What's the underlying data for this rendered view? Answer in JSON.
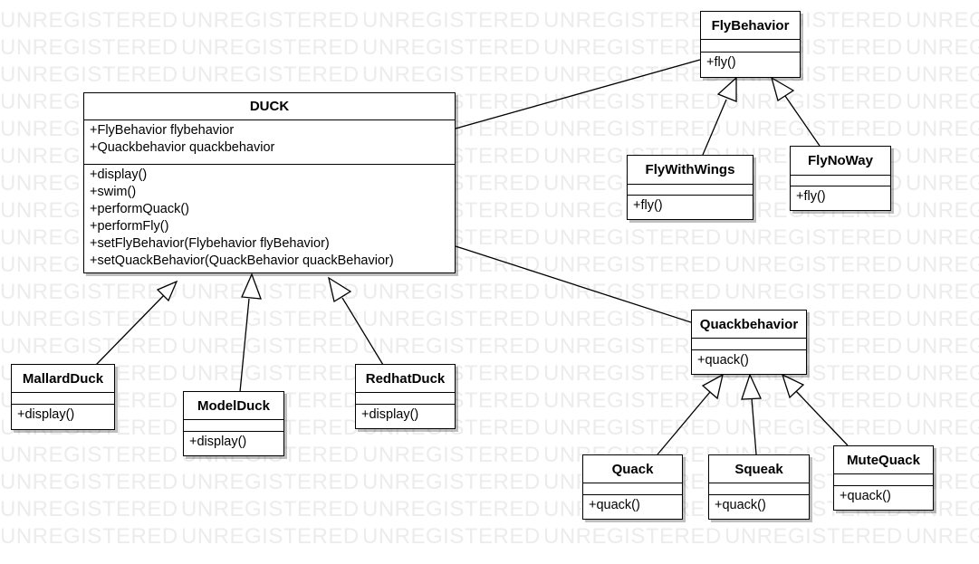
{
  "watermark_text": "UNREGISTERED",
  "classes": {
    "duck": {
      "name": "DUCK",
      "attributes": [
        "+FlyBehavior flybehavior",
        "+Quackbehavior quackbehavior"
      ],
      "operations": [
        "+display()",
        "+swim()",
        "+performQuack()",
        "+performFly()",
        "+setFlyBehavior(Flybehavior flyBehavior)",
        "+setQuackBehavior(QuackBehavior quackBehavior)"
      ]
    },
    "fly_behavior": {
      "name": "FlyBehavior",
      "operations": [
        "+fly()"
      ]
    },
    "fly_with_wings": {
      "name": "FlyWithWings",
      "operations": [
        "+fly()"
      ]
    },
    "fly_no_way": {
      "name": "FlyNoWay",
      "operations": [
        "+fly()"
      ]
    },
    "mallard_duck": {
      "name": "MallardDuck",
      "operations": [
        "+display()"
      ]
    },
    "model_duck": {
      "name": "ModelDuck",
      "operations": [
        "+display()"
      ]
    },
    "redhat_duck": {
      "name": "RedhatDuck",
      "operations": [
        "+display()"
      ]
    },
    "quack_behavior": {
      "name": "Quackbehavior",
      "operations": [
        "+quack()"
      ]
    },
    "quack": {
      "name": "Quack",
      "operations": [
        "+quack()"
      ]
    },
    "squeak": {
      "name": "Squeak",
      "operations": [
        "+quack()"
      ]
    },
    "mute_quack": {
      "name": "MuteQuack",
      "operations": [
        "+quack()"
      ]
    }
  }
}
